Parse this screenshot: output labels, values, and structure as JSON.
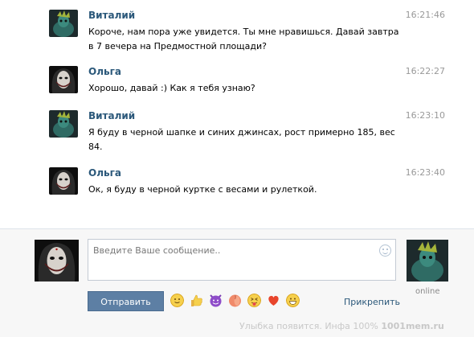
{
  "messages": [
    {
      "sender": "Виталий",
      "time": "16:21:46",
      "lines": [
        "Короче, нам пора уже увидется. Ты мне нравишься. Давай завтра",
        "в 7 вечера на Предмостной площади?"
      ]
    },
    {
      "sender": "Ольга",
      "time": "16:22:27",
      "lines": [
        "Хорошо, давай :) Как я тебя узнаю?"
      ]
    },
    {
      "sender": "Виталий",
      "time": "16:23:10",
      "lines": [
        "Я буду в черной шапке и синих джинсах, рост примерно 185, вес",
        "84."
      ]
    },
    {
      "sender": "Ольга",
      "time": "16:23:40",
      "lines": [
        "Ок, я буду в черной куртке с весами и рулеткой."
      ]
    }
  ],
  "composer": {
    "placeholder": "Введите Ваше сообщение..",
    "send_label": "Отправить",
    "attach_label": "Прикрепить",
    "online_label": "online",
    "emojis": [
      "slightly-smiling-face-icon",
      "thumbs-up-icon",
      "smiling-imp-icon",
      "peach-icon",
      "squinting-tongue-face-icon",
      "red-heart-icon",
      "grinning-face-icon"
    ]
  },
  "watermark": {
    "text": "Улыбка появится. Инфа 100%",
    "brand": "1001mem.ru"
  },
  "colors": {
    "name_link": "#2b587a",
    "button": "#5d7fa4",
    "timestamp": "#999999"
  }
}
